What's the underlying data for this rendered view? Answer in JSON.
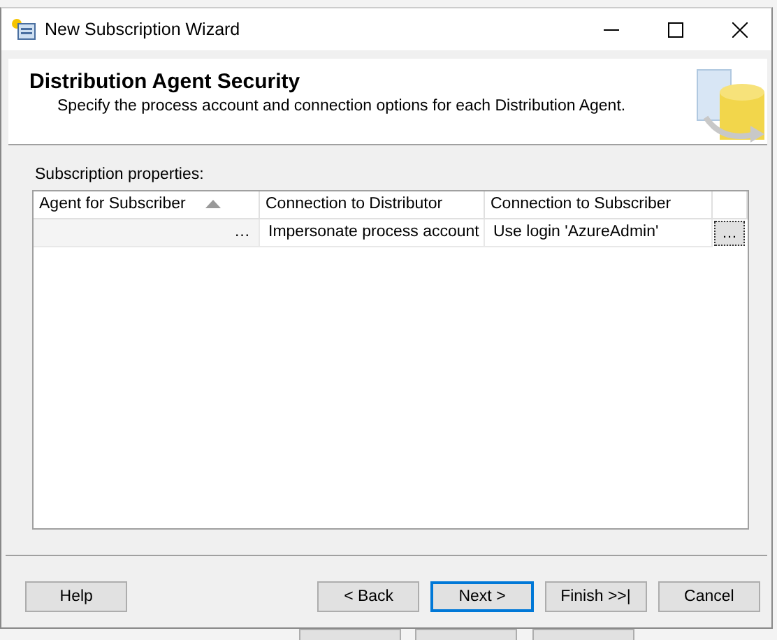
{
  "window": {
    "title": "New Subscription Wizard"
  },
  "header": {
    "title": "Distribution Agent Security",
    "subtitle": "Specify the process account and connection options for each Distribution Agent."
  },
  "grid": {
    "label": "Subscription properties:",
    "columns": [
      {
        "label": "Agent for Subscriber",
        "sorted": true
      },
      {
        "label": "Connection to Distributor",
        "sorted": false
      },
      {
        "label": "Connection to Subscriber",
        "sorted": false
      }
    ],
    "rows": [
      {
        "cells": [
          "…",
          "Impersonate process account",
          "Use login 'AzureAdmin'"
        ],
        "button": "…"
      }
    ]
  },
  "buttons": [
    {
      "label": "Help",
      "default": false
    },
    {
      "label": "< Back",
      "default": false
    },
    {
      "label": "Next >",
      "default": true
    },
    {
      "label": "Finish >>|",
      "default": false
    },
    {
      "label": "Cancel",
      "default": false
    }
  ]
}
